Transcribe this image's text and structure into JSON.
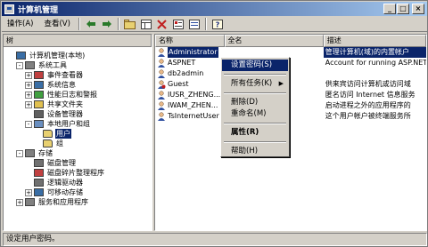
{
  "window": {
    "title": "计算机管理"
  },
  "menubar": {
    "items": [
      "操作(A)",
      "查看(V)"
    ]
  },
  "left_pane": {
    "header": "树",
    "tree": [
      {
        "label": "计算机管理(本地)",
        "indent": 0,
        "expander": "",
        "icon": "computer-icon",
        "color": "#3a6ea5"
      },
      {
        "label": "系统工具",
        "indent": 1,
        "expander": "-",
        "icon": "tools-icon",
        "color": "#808080"
      },
      {
        "label": "事件查看器",
        "indent": 2,
        "expander": "+",
        "icon": "event-viewer-icon",
        "color": "#c04040"
      },
      {
        "label": "系统信息",
        "indent": 2,
        "expander": "+",
        "icon": "system-info-icon",
        "color": "#3a6ea5"
      },
      {
        "label": "性能日志和警报",
        "indent": 2,
        "expander": "+",
        "icon": "performance-icon",
        "color": "#40a040"
      },
      {
        "label": "共享文件夹",
        "indent": 2,
        "expander": "+",
        "icon": "shared-folder-icon",
        "color": "#e0c050"
      },
      {
        "label": "设备管理器",
        "indent": 2,
        "expander": "",
        "icon": "device-manager-icon",
        "color": "#606060"
      },
      {
        "label": "本地用户和组",
        "indent": 2,
        "expander": "-",
        "icon": "users-groups-icon",
        "color": "#6a8fc0"
      },
      {
        "label": "用户",
        "indent": 3,
        "expander": "",
        "icon": "folder-icon",
        "color": "#e8d070",
        "selected": true
      },
      {
        "label": "组",
        "indent": 3,
        "expander": "",
        "icon": "folder-icon",
        "color": "#e8d070"
      },
      {
        "label": "存储",
        "indent": 1,
        "expander": "-",
        "icon": "storage-icon",
        "color": "#808080"
      },
      {
        "label": "磁盘管理",
        "indent": 2,
        "expander": "",
        "icon": "disk-icon",
        "color": "#707070"
      },
      {
        "label": "磁盘碎片整理程序",
        "indent": 2,
        "expander": "",
        "icon": "defrag-icon",
        "color": "#c04040"
      },
      {
        "label": "逻辑驱动器",
        "indent": 2,
        "expander": "",
        "icon": "drive-icon",
        "color": "#707070"
      },
      {
        "label": "可移动存储",
        "indent": 2,
        "expander": "+",
        "icon": "removable-storage-icon",
        "color": "#3a6ea5"
      },
      {
        "label": "服务和应用程序",
        "indent": 1,
        "expander": "+",
        "icon": "services-icon",
        "color": "#808080"
      }
    ]
  },
  "right_pane": {
    "columns": [
      "名称",
      "全名",
      "描述"
    ],
    "rows": [
      {
        "name": "Administrator",
        "full": "",
        "desc": "管理计算机(域)的内置帐户",
        "selected": true
      },
      {
        "name": "ASPNET",
        "full": "",
        "desc": "Account for running ASP.NET W"
      },
      {
        "name": "db2admin",
        "full": "",
        "desc": ""
      },
      {
        "name": "Guest",
        "full": "",
        "desc": "供来宾访问计算机或访问域"
      },
      {
        "name": "IUSR_ZHENG...",
        "full": "",
        "desc": "匿名访问 Internet 信息服务"
      },
      {
        "name": "IWAM_ZHEN...",
        "full": "",
        "desc": "启动进程之外的应用程序的"
      },
      {
        "name": "TsInternetUser",
        "full": "",
        "desc": "这个用户帐户被终端服务所"
      }
    ]
  },
  "context_menu": {
    "items": [
      {
        "label": "设置密码(S)",
        "highlight": true
      },
      {
        "sep": true
      },
      {
        "label": "所有任务(K)",
        "submenu": true
      },
      {
        "sep": true
      },
      {
        "label": "删除(D)"
      },
      {
        "label": "重命名(M)"
      },
      {
        "sep": true
      },
      {
        "label": "属性(R)",
        "bold": true
      },
      {
        "sep": true
      },
      {
        "label": "帮助(H)"
      }
    ]
  },
  "statusbar": {
    "text": "设定用户密码。"
  },
  "colors": {
    "title_bar": "#0a246a",
    "selection": "#0a246a",
    "chrome": "#d4d0c8"
  }
}
